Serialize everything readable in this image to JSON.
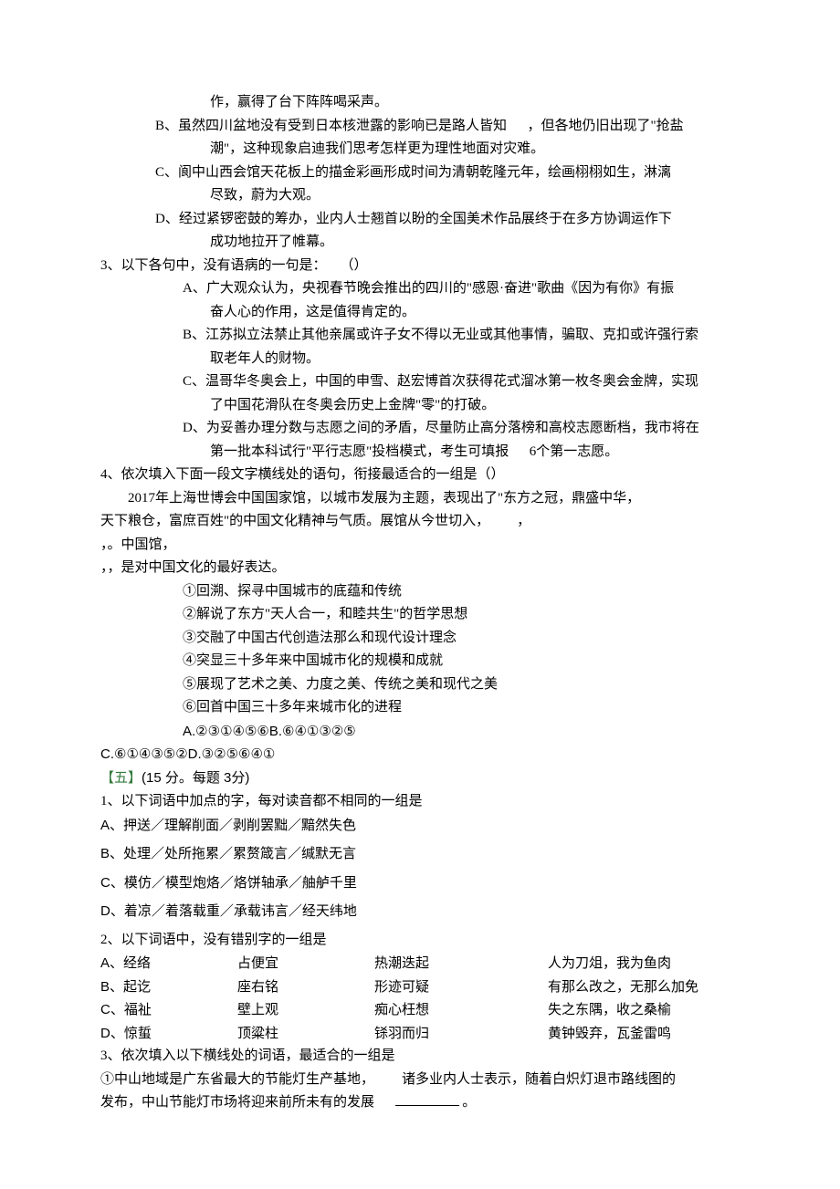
{
  "topPartial": {
    "line1": "作，赢得了台下阵阵喝采声。",
    "optB1": "B、虽然四川盆地没有受到日本核泄露的影响已是路人皆知",
    "optB2": "，但各地仍旧出现了\"抢盐",
    "optB3": "潮\"，这种现象启迪我们思考怎样更为理性地面对灾难。",
    "optC1": "C、阆中山西会馆天花板上的描金彩画形成时间为清朝乾隆元年，绘画栩栩如生，淋漓",
    "optC2": "尽致，蔚为大观。",
    "optD1": "D、经过紧锣密鼓的筹办，业内人士翘首以盼的全国美术作品展终于在多方协调运作下",
    "optD2": "成功地拉开了帷幕。"
  },
  "q3": {
    "stem": "3、以下各句中，没有语病的一句是：　　（）",
    "A1": "A、广大观众认为，央视春节晚会推出的四川的\"感恩·奋进\"歌曲《因为有你》有振",
    "A2": "奋人心的作用，这是值得肯定的。",
    "B1": "B、江苏拟立法禁止其他亲属或许子女不得以无业或其他事情，骗取、克扣或许强行索",
    "B2": "取老年人的财物。",
    "C1": "C、温哥华冬奥会上，中国的申雪、赵宏博首次获得花式溜冰第一枚冬奥会金牌，实现",
    "C2": "了中国花滑队在冬奥会历史上金牌\"零\"的打破。",
    "D1": "D、为妥善办理分数与志愿之间的矛盾，尽量防止高分落榜和高校志愿断档，我市将在",
    "D2a": "第一批本科试行\"平行志愿\"投档模式，考生可填报",
    "D2b": "6个第一志愿。"
  },
  "q4": {
    "stem": "4、依次填入下面一段文字横线处的语句，衔接最适合的一组是（）",
    "p1a": "2017年上海世博会中国国家馆，以城市发展为主题，表现出了\"东方之冠，鼎盛中华，",
    "p1b": "天下粮仓，富庶百姓\"的中国文化精神与气质。展馆从今世切入，",
    "p1c": "，",
    "p2": "，。中国馆，",
    "p3": "，，是对中国文化的最好表达。",
    "i1": "①回溯、探寻中国城市的底蕴和传统",
    "i2": "②解说了东方\"天人合一，和睦共生\"的哲学思想",
    "i3": "③交融了中国古代创造法那么和现代设计理念",
    "i4": "④突显三十多年来中国城市化的规模和成就",
    "i5": "⑤展现了艺术之美、力度之美、传统之美和现代之美",
    "i6": "⑥回首中国三十多年来城市化的进程",
    "optAB": "A.②③①④⑤⑥B.⑥④①③②⑤",
    "optCD": "C.⑥①④③⑤②D.③②⑤⑥④①"
  },
  "sec5": {
    "headA": "【五】",
    "headB": "(15  分。每题  3分)",
    "q1stem": "1、以下词语中加点的字，每对读音都不相同的一组是",
    "q1A": "A、押送／理解削面／剥削罢黜／黯然失色",
    "q1B": "B、处理／处所拖累／累赘箴言／缄默无言",
    "q1C": "C、模仿／模型炮烙／烙饼轴承／舳舻千里",
    "q1D": "D、着凉／着落载重／承载讳言／经天纬地",
    "q2stem": "2、以下词语中，没有错别字的一组是",
    "q2A": [
      "A、经络",
      "占便宜",
      "热潮迭起",
      "人为刀俎，我为鱼肉"
    ],
    "q2B": [
      "B、起讫",
      "座右铭",
      "形迹可疑",
      "有那么改之，无那么加免"
    ],
    "q2C": [
      "C、福祉",
      "壁上观",
      "痴心枉想",
      "失之东隅，收之桑榆"
    ],
    "q2D": [
      "D、惊蜇",
      "顶粱柱",
      "铩羽而归",
      "黄钟毁弃，瓦釜雷鸣"
    ],
    "q3stem": "3、依次填入以下横线处的词语，最适合的一组是",
    "q3p1a": "①中山地域是广东省最大的节能灯生产基地，",
    "q3p1b": "诸多业内人士表示，随着白炽灯退市路线图的",
    "q3p2a": "发布，中山节能灯市场将迎来前所未有的发展",
    "q3p2b": "。"
  }
}
